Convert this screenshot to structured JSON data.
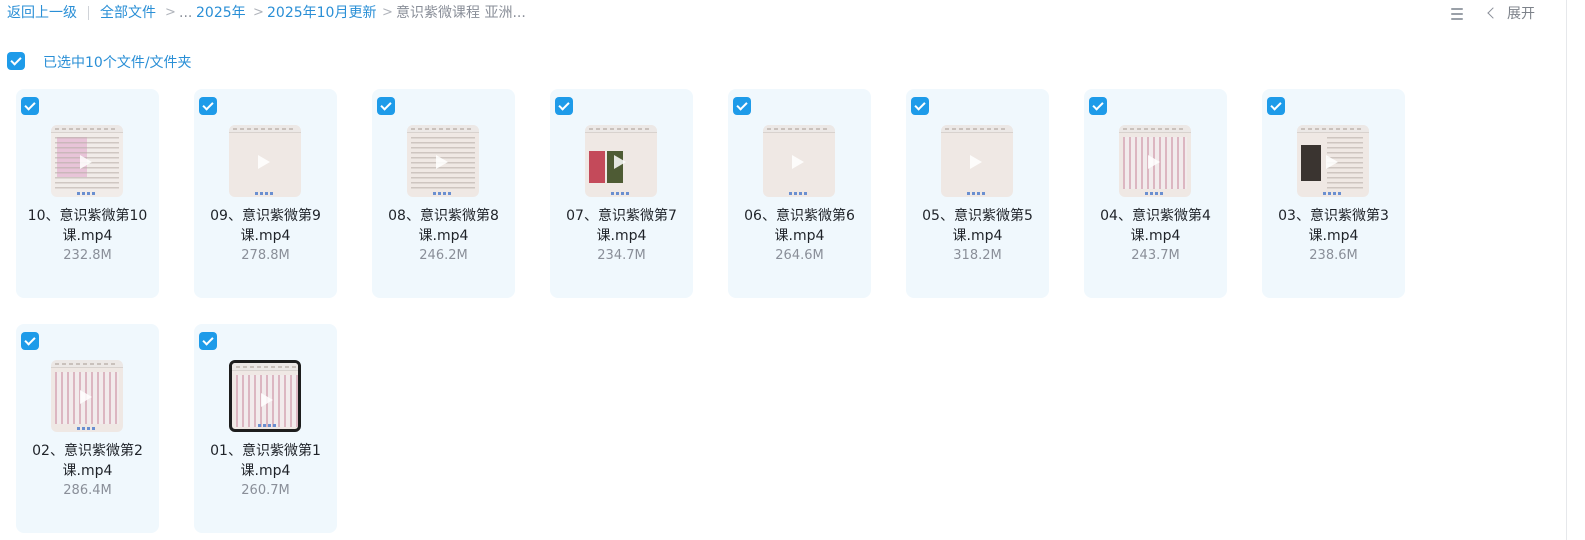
{
  "breadcrumb": {
    "back": "返回上一级",
    "all_files": "全部文件",
    "ellipsis": "...",
    "year": "2025年",
    "month": "2025年10月更新",
    "current": "意识紫微课程 亚洲...",
    "separator": ">"
  },
  "toolbar": {
    "expand_label": "展开"
  },
  "selection": {
    "text": "已选中10个文件/文件夹"
  },
  "colors": {
    "accent": "#1e9be9",
    "card_bg": "#f0f8fd",
    "link": "#2a8fd6"
  },
  "files": [
    {
      "name": "10、意识紫微第10",
      "name2": "课.mp4",
      "size": "232.8M",
      "thumb": "pink"
    },
    {
      "name": "09、意识紫微第9",
      "name2": "课.mp4",
      "size": "278.8M",
      "thumb": "plain"
    },
    {
      "name": "08、意识紫微第8",
      "name2": "课.mp4",
      "size": "246.2M",
      "thumb": "text"
    },
    {
      "name": "07、意识紫微第7",
      "name2": "课.mp4",
      "size": "234.7M",
      "thumb": "book"
    },
    {
      "name": "06、意识紫微第6",
      "name2": "课.mp4",
      "size": "264.6M",
      "thumb": "plain"
    },
    {
      "name": "05、意识紫微第5",
      "name2": "课.mp4",
      "size": "318.2M",
      "thumb": "plain"
    },
    {
      "name": "04、意识紫微第4",
      "name2": "课.mp4",
      "size": "243.7M",
      "thumb": "chart"
    },
    {
      "name": "03、意识紫微第3",
      "name2": "课.mp4",
      "size": "238.6M",
      "thumb": "dark"
    },
    {
      "name": "02、意识紫微第2",
      "name2": "课.mp4",
      "size": "286.4M",
      "thumb": "chart"
    },
    {
      "name": "01、意识紫微第1",
      "name2": "课.mp4",
      "size": "260.7M",
      "thumb": "black"
    }
  ]
}
